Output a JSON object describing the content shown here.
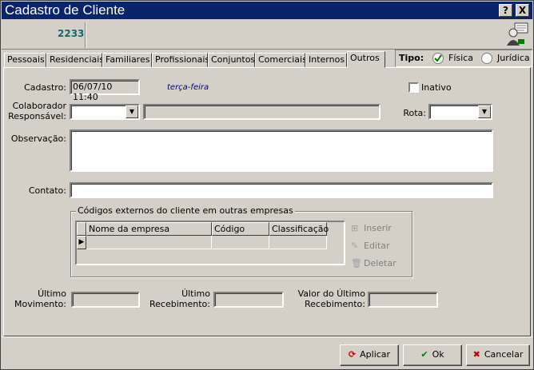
{
  "window": {
    "title": "Cadastro de Cliente",
    "help_btn": "?",
    "close_btn": "X"
  },
  "header": {
    "code": "2233"
  },
  "tabs": [
    {
      "label": "Pessoais"
    },
    {
      "label": "Residenciais"
    },
    {
      "label": "Familiares"
    },
    {
      "label": "Profissionais"
    },
    {
      "label": "Conjuntos"
    },
    {
      "label": "Comerciais"
    },
    {
      "label": "Internos"
    },
    {
      "label": "Outros"
    }
  ],
  "tipo": {
    "label": "Tipo:",
    "fisica": "Física",
    "juridica": "Jurídica",
    "selected": "Física"
  },
  "form": {
    "cadastro_label": "Cadastro:",
    "cadastro_value": "06/07/10 11:40",
    "weekday": "terça-feira",
    "inativo_label": "Inativo",
    "colaborador_label_1": "Colaborador",
    "colaborador_label_2": "Responsável:",
    "rota_label": "Rota:",
    "observacao_label": "Observação:",
    "contato_label": "Contato:"
  },
  "codigos": {
    "title": "Códigos externos do cliente em outras empresas",
    "columns": [
      "Nome da empresa",
      "Código",
      "Classificação"
    ],
    "buttons": {
      "inserir": "Inserir",
      "editar": "Editar",
      "deletar": "Deletar"
    }
  },
  "footer_fields": {
    "ultimo_mov_1": "Último",
    "ultimo_mov_2": "Movimento:",
    "ultimo_rec_1": "Último",
    "ultimo_rec_2": "Recebimento:",
    "valor_rec_1": "Valor do Último",
    "valor_rec_2": "Recebimento:"
  },
  "actions": {
    "aplicar": "Aplicar",
    "ok": "Ok",
    "cancelar": "Cancelar"
  },
  "colors": {
    "title_bar": "#0a246a",
    "code_text": "#0f6b6b",
    "weekday_text": "#000080",
    "ok_icon": "#008000",
    "cancel_icon": "#c00000"
  }
}
